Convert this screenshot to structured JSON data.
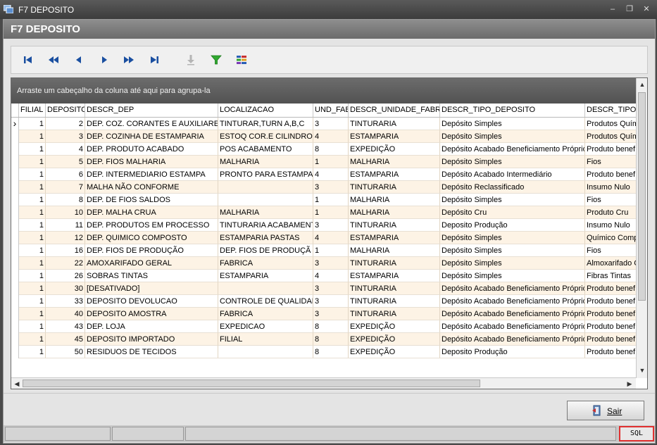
{
  "window": {
    "title": "F7 DEPOSITO",
    "controls": [
      "minimize-icon",
      "restore-icon",
      "close-icon"
    ]
  },
  "header": {
    "title": "F7 DEPOSITO"
  },
  "toolbar": {
    "buttons": [
      {
        "name": "first-record-icon"
      },
      {
        "name": "prior-page-icon"
      },
      {
        "name": "prior-record-icon"
      },
      {
        "name": "next-record-icon"
      },
      {
        "name": "next-page-icon"
      },
      {
        "name": "last-record-icon"
      },
      {
        "name": "export-disabled-icon"
      },
      {
        "name": "filter-icon"
      },
      {
        "name": "columns-icon"
      }
    ]
  },
  "grid": {
    "group_hint": "Arraste um cabeçalho da coluna até aqui para agrupa-la",
    "columns": [
      "FILIAL",
      "DEPOSITO",
      "DESCR_DEP",
      "LOCALIZACAO",
      "UND_FAB",
      "DESCR_UNIDADE_FABRIL",
      "DESCR_TIPO_DEPOSITO",
      "DESCR_TIPO_"
    ],
    "rows": [
      [
        "1",
        "2",
        "DEP. COZ. CORANTES E AUXILIARE",
        "TINTURAR,TURN A,B,C",
        "3",
        "TINTURARIA",
        "Depósito Simples",
        "Produtos Quím"
      ],
      [
        "1",
        "3",
        "DEP. COZINHA DE ESTAMPARIA",
        "ESTOQ COR.E CILINDRO",
        "4",
        "ESTAMPARIA",
        "Depósito Simples",
        "Produtos Quím"
      ],
      [
        "1",
        "4",
        "DEP. PRODUTO ACABADO",
        "POS ACABAMENTO",
        "8",
        "EXPEDIÇÃO",
        "Depósito Acabado Beneficiamento Próprio",
        "Produto benef"
      ],
      [
        "1",
        "5",
        "DEP. FIOS MALHARIA",
        "MALHARIA",
        "1",
        "MALHARIA",
        "Depósito Simples",
        "Fios"
      ],
      [
        "1",
        "6",
        "DEP. INTERMEDIARIO ESTAMPA",
        "PRONTO PARA ESTAMPAR",
        "4",
        "ESTAMPARIA",
        "Depósito Acabado Intermediário",
        "Produto benef"
      ],
      [
        "1",
        "7",
        "MALHA NÃO CONFORME",
        "",
        "3",
        "TINTURARIA",
        "Depósito Reclassificado",
        "Insumo Nulo"
      ],
      [
        "1",
        "8",
        "DEP. DE FIOS SALDOS",
        "",
        "1",
        "MALHARIA",
        "Depósito Simples",
        "Fios"
      ],
      [
        "1",
        "10",
        "DEP. MALHA CRUA",
        "MALHARIA",
        "1",
        "MALHARIA",
        "Depósito Cru",
        "Produto Cru"
      ],
      [
        "1",
        "11",
        "DEP. PRODUTOS EM PROCESSO",
        "TINTURARIA ACABAMENT",
        "3",
        "TINTURARIA",
        "Deposito Produção",
        "Insumo Nulo"
      ],
      [
        "1",
        "12",
        "DEP. QUIMICO COMPOSTO",
        "ESTAMPARIA PASTAS",
        "4",
        "ESTAMPARIA",
        "Depósito Simples",
        "Químico Compo"
      ],
      [
        "1",
        "16",
        "DEP. FIOS DE PRODUÇÃO",
        "DEP. FIOS DE PRODUÇÃ",
        "1",
        "MALHARIA",
        "Depósito Simples",
        "Fios"
      ],
      [
        "1",
        "22",
        "AMOXARIFADO GERAL",
        "FABRICA",
        "3",
        "TINTURARIA",
        "Depósito Simples",
        "Almoxarifado G"
      ],
      [
        "1",
        "26",
        "SOBRAS TINTAS",
        "ESTAMPARIA",
        "4",
        "ESTAMPARIA",
        "Depósito Simples",
        "Fibras Tintas"
      ],
      [
        "1",
        "30",
        "[DESATIVADO]",
        "",
        "3",
        "TINTURARIA",
        "Depósito Acabado Beneficiamento Próprio",
        "Produto benef"
      ],
      [
        "1",
        "33",
        "DEPOSITO DEVOLUCAO",
        "CONTROLE DE QUALIDAD",
        "3",
        "TINTURARIA",
        "Depósito Acabado Beneficiamento Próprio",
        "Produto benef"
      ],
      [
        "1",
        "40",
        "DEPOSITO AMOSTRA",
        "FABRICA",
        "3",
        "TINTURARIA",
        "Depósito Acabado Beneficiamento Próprio",
        "Produto benef"
      ],
      [
        "1",
        "43",
        "DEP. LOJA",
        "EXPEDICAO",
        "8",
        "EXPEDIÇÃO",
        "Depósito Acabado Beneficiamento Próprio",
        "Produto benef"
      ],
      [
        "1",
        "45",
        "DEPOSITO IMPORTADO",
        "FILIAL",
        "8",
        "EXPEDIÇÃO",
        "Depósito Acabado Beneficiamento Próprio",
        "Produto benef"
      ],
      [
        "1",
        "50",
        "RESIDUOS DE TECIDOS",
        "",
        "8",
        "EXPEDIÇÃO",
        "Deposito Produção",
        "Produto benef"
      ]
    ]
  },
  "footer": {
    "exit_label": "Sair",
    "sql_label": "SQL"
  },
  "colors": {
    "row_alt": "#fdf3e5",
    "highlight": "#e03030",
    "filter": "#2fa82f",
    "nav": "#1a4fa0"
  }
}
